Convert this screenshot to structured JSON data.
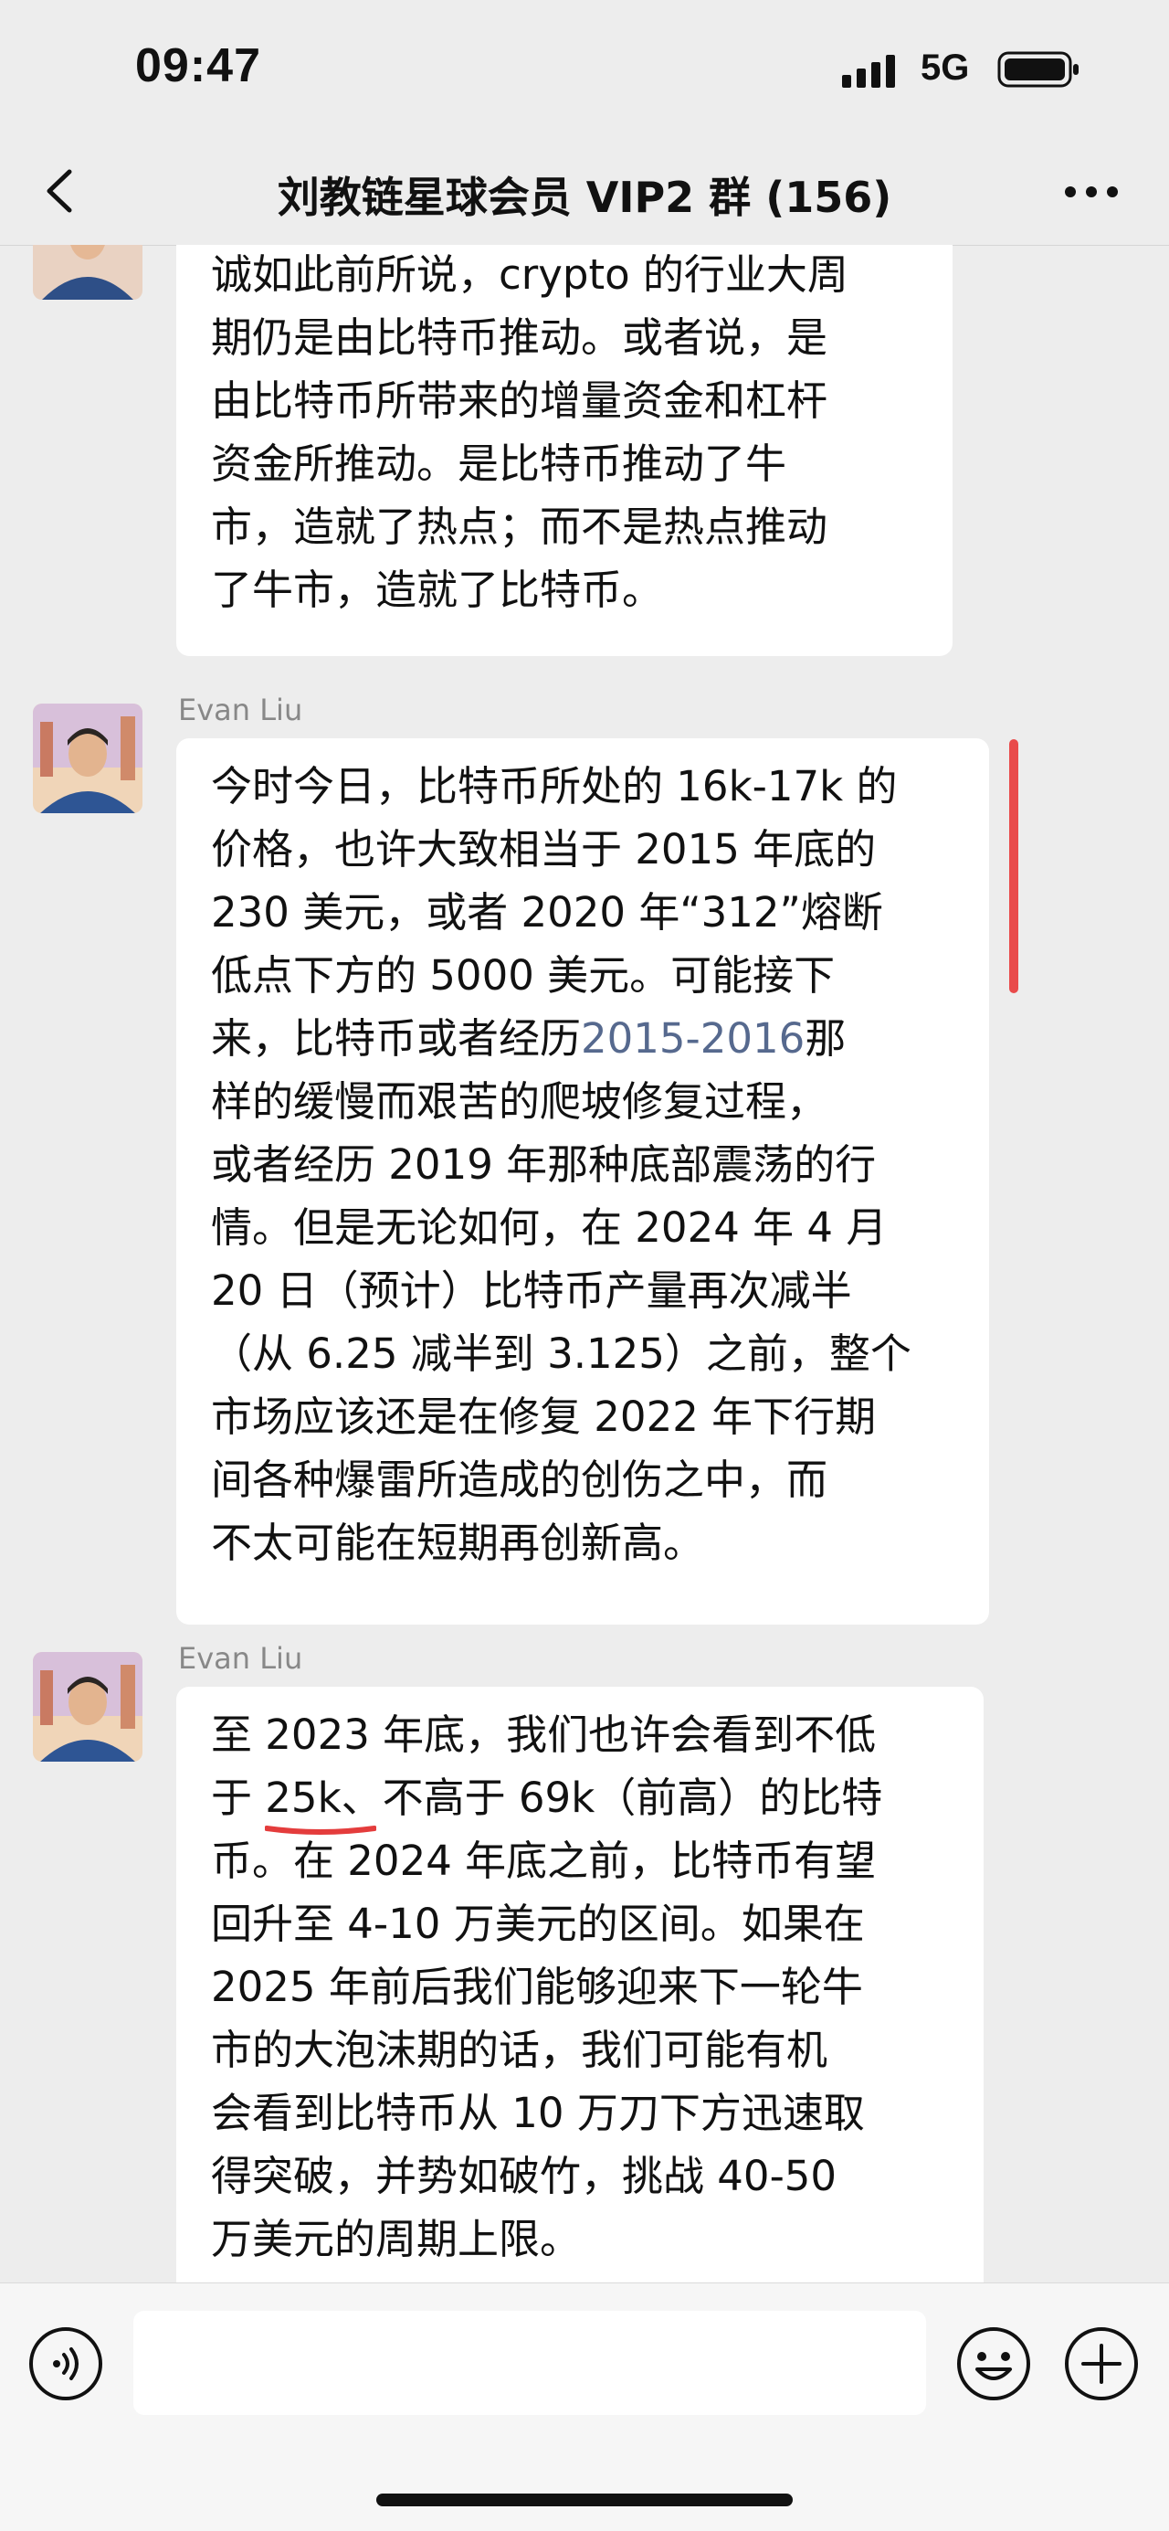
{
  "status_bar": {
    "time": "09:47",
    "network": "5G"
  },
  "nav": {
    "title": "刘教链星球会员 VIP2 群 (156)"
  },
  "messages": [
    {
      "sender": "",
      "lines": [
        "诚如此前所说，crypto 的行业大周",
        "期仍是由比特币推动。或者说，是",
        "由比特币所带来的增量资金和杠杆",
        "资金所推动。是比特币推动了牛",
        "市，造就了热点；而不是热点推动",
        "了牛市，造就了比特币。"
      ]
    },
    {
      "sender": "Evan Liu",
      "lines": [
        "今时今日，比特币所处的 16k-17k 的",
        "价格，也许大致相当于 2015 年底的",
        "230 美元，或者 2020 年“312”熔断",
        "低点下方的 5000 美元。可能接下",
        "来，比特币或者经历",
        "样的缓慢而艰苦的爬坡修复过程，",
        "或者经历 2019 年那种底部震荡的行",
        "情。但是无论如何，在 2024 年 4 月",
        "20 日（预计）比特币产量再次减半",
        "（从 6.25 减半到 3.125）之前，整个",
        "市场应该还是在修复 2022 年下行期",
        "间各种爆雷所造成的创伤之中，而",
        "不太可能在短期再创新高。"
      ],
      "link_text": "2015-2016",
      "link_suffix": "那"
    },
    {
      "sender": "Evan Liu",
      "lines": [
        "至 2023 年底，我们也许会看到不低",
        "于 25k、不高于 69k（前高）的比特",
        "币。在 2024 年底之前，比特币有望",
        "回升至 4-10 万美元的区间。如果在",
        "2025 年前后我们能够迎来下一轮牛",
        "市的大泡沫期的话，我们可能有机",
        "会看到比特币从 10 万刀下方迅速取",
        "得突破，并势如破竹，挑战 40-50",
        "万美元的周期上限。"
      ]
    }
  ],
  "colors": {
    "background": "#ededed",
    "bubble": "#ffffff",
    "link": "#56698e",
    "red_marker": "#e94b4b"
  }
}
